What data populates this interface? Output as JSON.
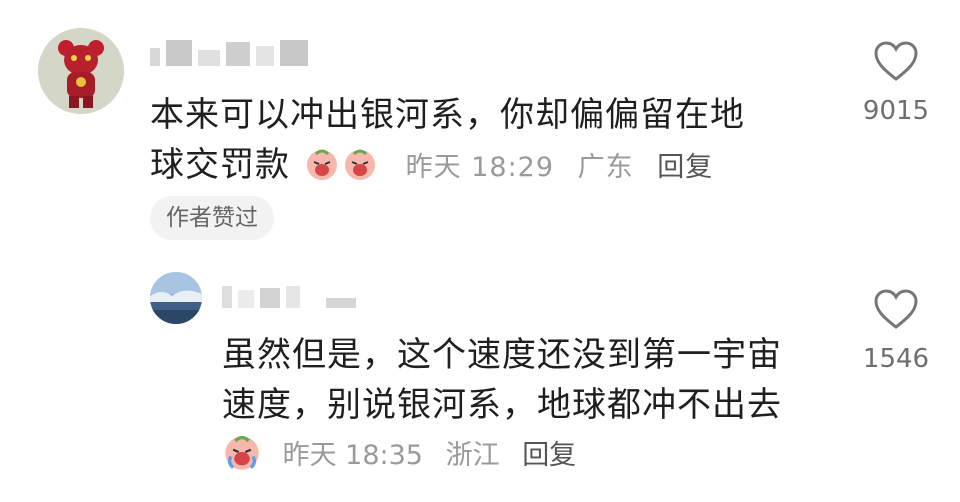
{
  "comments": [
    {
      "text_line1": "本来可以冲出银河系，你却偏偏留在地",
      "text_line2": "球交罚款",
      "time": "昨天 18:29",
      "location": "广东",
      "reply_label": "回复",
      "badge": "作者赞过",
      "likes": "9015",
      "emoji": "crying-face-emoji"
    },
    {
      "text_line1": "虽然但是，这个速度还没到第一宇宙",
      "text_line2": "速度，别说银河系，地球都冲不出去",
      "time": "昨天 18:35",
      "location": "浙江",
      "reply_label": "回复",
      "likes": "1546",
      "emoji": "crying-face-emoji"
    }
  ],
  "colors": {
    "meta": "#9a9a9a",
    "text": "#1f1f1f",
    "badge_bg": "#f2f2f2"
  }
}
